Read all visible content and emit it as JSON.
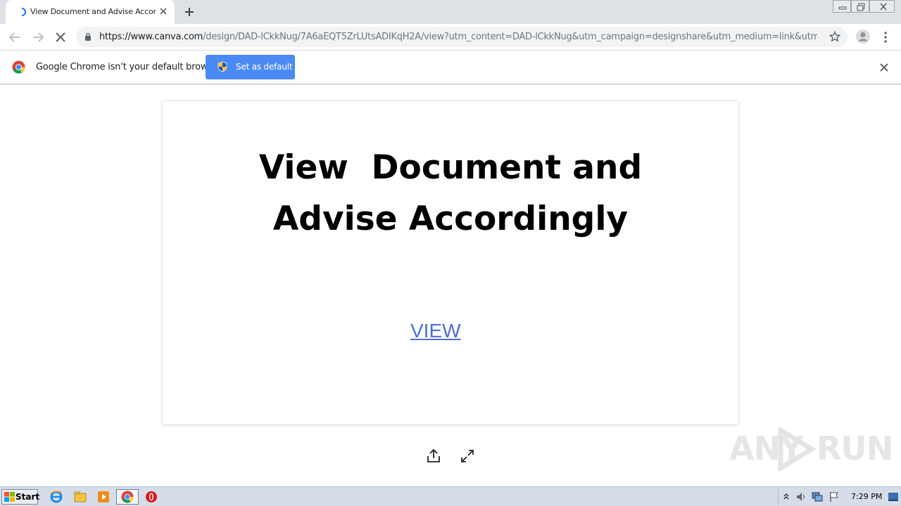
{
  "browser": {
    "tab_title": "View Document and Advise Accordingly",
    "url_host": "https://www.canva.com",
    "url_path": "/design/DAD-lCkkNug/7A6aEQT5ZrLUtsADIKqH2A/view?utm_content=DAD-lCkkNug&utm_campaign=designshare&utm_medium=link&utm..."
  },
  "infobar": {
    "message": "Google Chrome isn't your default browser",
    "button_label": "Set as default"
  },
  "card": {
    "headline_line1": "View  Document and",
    "headline_line2": "Advise Accordingly",
    "link_label": "VIEW",
    "link_color": "#4f6fd8"
  },
  "watermark": {
    "text_left": "ANY",
    "text_right": "RUN"
  },
  "taskbar": {
    "start_label": "Start",
    "clock": "7:29 PM"
  },
  "colors": {
    "accent_button": "#4a8af4",
    "tab_strip": "#dee1e6"
  }
}
